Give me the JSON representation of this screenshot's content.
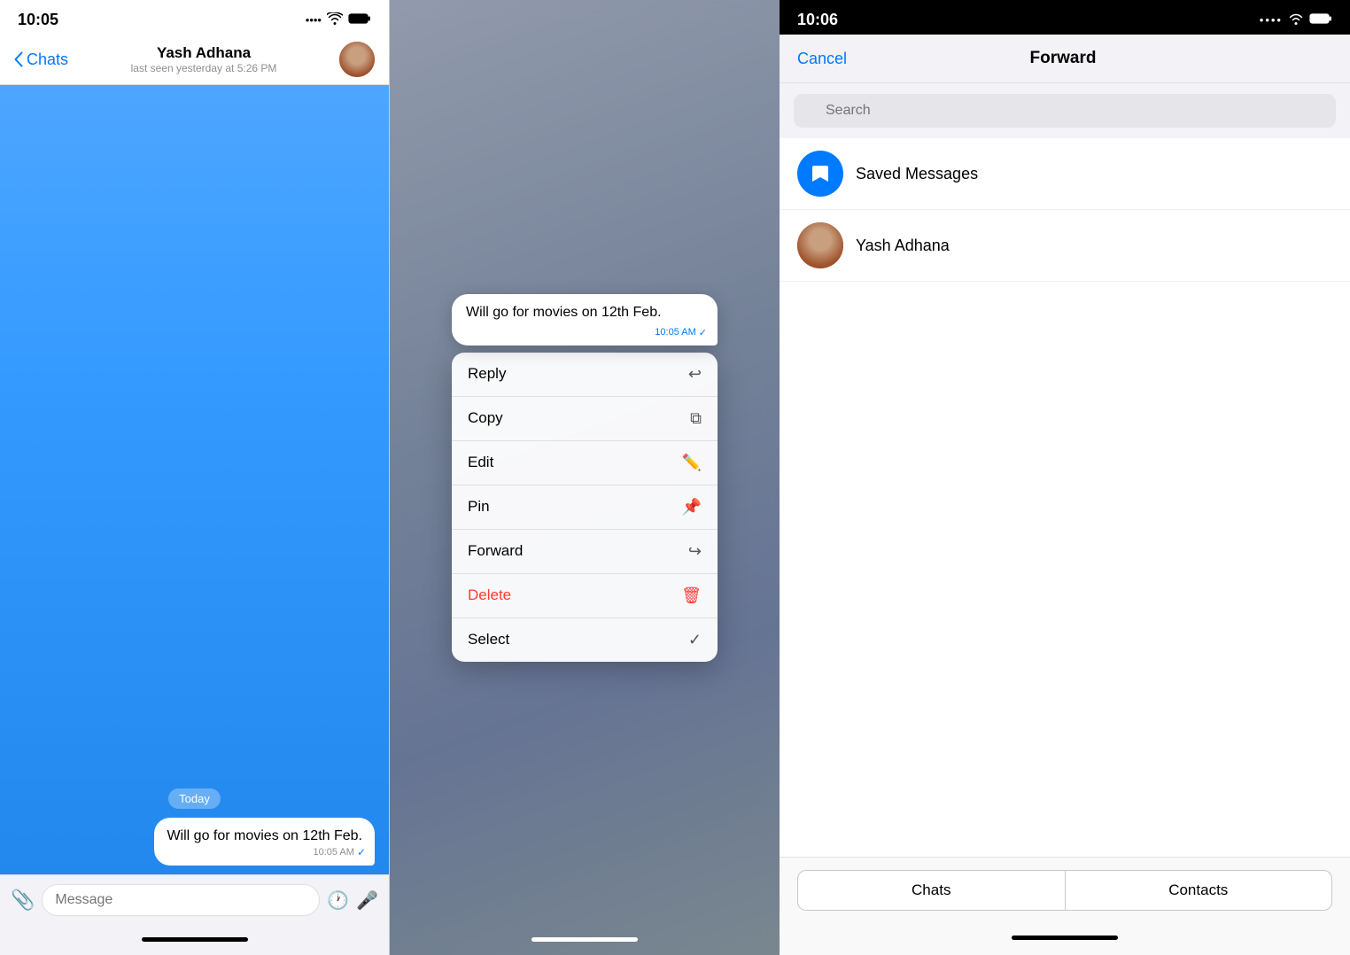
{
  "panel1": {
    "statusBar": {
      "time": "10:05",
      "signal": ".....",
      "wifi": "wifi",
      "battery": "battery"
    },
    "header": {
      "backLabel": "Chats",
      "contactName": "Yash Adhana",
      "contactStatus": "last seen yesterday at 5:26 PM"
    },
    "chat": {
      "dateBadge": "Today",
      "message": "Will go for movies on 12th Feb.",
      "messageTime": "10:05 AM",
      "inputPlaceholder": "Message"
    }
  },
  "panel2": {
    "messagePreview": {
      "text": "Will go for movies on 12th Feb.",
      "time": "10:05 AM"
    },
    "contextMenu": {
      "items": [
        {
          "label": "Reply",
          "icon": "↩",
          "type": "normal"
        },
        {
          "label": "Copy",
          "icon": "⧉",
          "type": "normal"
        },
        {
          "label": "Edit",
          "icon": "✎",
          "type": "normal"
        },
        {
          "label": "Pin",
          "icon": "📌",
          "type": "normal"
        },
        {
          "label": "Forward",
          "icon": "↪",
          "type": "normal"
        },
        {
          "label": "Delete",
          "icon": "🗑",
          "type": "delete"
        },
        {
          "label": "Select",
          "icon": "✓",
          "type": "normal"
        }
      ]
    }
  },
  "panel3": {
    "statusBar": {
      "time": "10:06",
      "signal": ".....",
      "wifi": "wifi",
      "battery": "battery"
    },
    "header": {
      "cancelLabel": "Cancel",
      "title": "Forward"
    },
    "search": {
      "placeholder": "Search"
    },
    "contacts": [
      {
        "name": "Saved Messages",
        "type": "bookmark"
      },
      {
        "name": "Yash Adhana",
        "type": "user"
      }
    ],
    "tabs": [
      {
        "label": "Chats"
      },
      {
        "label": "Contacts"
      }
    ]
  }
}
